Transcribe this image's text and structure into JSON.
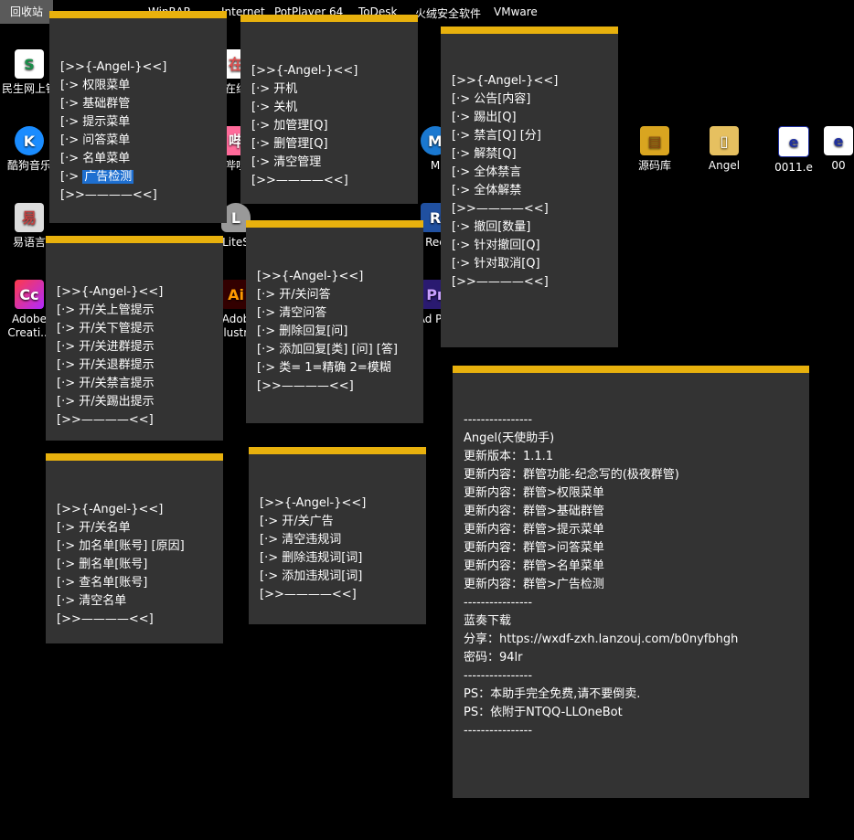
{
  "desktop": {
    "recycle_bin": "回收站",
    "top_labels": [
      "WinRAR",
      "Internet",
      "PotPlayer 64",
      "ToDesk",
      "火绒安全软件",
      "VMware"
    ],
    "icons": [
      {
        "label": "民生网上银",
        "icon": "bank-icon",
        "color": "#1a8f4a",
        "char": "S"
      },
      {
        "label": "酷狗音乐",
        "icon": "kugou-icon",
        "color": "#1a8cff",
        "char": "K"
      },
      {
        "label": "易语言",
        "icon": "eyuyan-icon",
        "color": "#c04040",
        "char": "易"
      },
      {
        "label": "Adobe Creati...",
        "icon": "adobe-cc-icon",
        "color": "#e8336f",
        "char": "Cc"
      },
      {
        "label": "在线",
        "icon": "app-icon",
        "color": "#e05050",
        "char": "在"
      },
      {
        "label": "哔哩",
        "icon": "bilibili-icon",
        "color": "#ff6a9a",
        "char": "哔"
      },
      {
        "label": "LiteS",
        "icon": "db-icon",
        "color": "#888888",
        "char": "L"
      },
      {
        "label": "Adob Illustra",
        "icon": "illustrator-icon",
        "color": "#ff9a00",
        "char": "Ai"
      },
      {
        "label": "M",
        "icon": "app-icon-m",
        "color": "#1a78d0",
        "char": "M"
      },
      {
        "label": "Rec",
        "icon": "rec-icon",
        "color": "#2050a0",
        "char": "R"
      },
      {
        "label": "Ad Pre",
        "icon": "premiere-icon",
        "color": "#2a1a70",
        "char": "Pr"
      },
      {
        "label": "源码库",
        "icon": "folder-zip-icon",
        "color": "#d9a520",
        "char": "▤"
      },
      {
        "label": "Angel",
        "icon": "folder-icon",
        "color": "#e6c060",
        "char": "▯"
      },
      {
        "label": "0011.e",
        "icon": "e-file-icon",
        "color": "#2030a0",
        "char": "e"
      },
      {
        "label": "00",
        "icon": "e-file-icon-2",
        "color": "#2030a0",
        "char": "e"
      }
    ]
  },
  "panels": {
    "permissions": [
      "[>>{-Angel-}<<]",
      "[·> 权限菜单",
      "[·> 基础群管",
      "[·> 提示菜单",
      "[·> 问答菜单",
      "[·> 名单菜单",
      "[·> ",
      "[>>————<<]"
    ],
    "permissions_highlight": "广告检测",
    "basic": [
      "[>>{-Angel-}<<]",
      "[·> 开机",
      "[·> 关机",
      "[·> 加管理[Q]",
      "[·> 删管理[Q]",
      "[·> 清空管理",
      "[>>————<<]"
    ],
    "group": [
      "[>>{-Angel-}<<]",
      "[·> 公告[内容]",
      "[·> 踢出[Q]",
      "[·> 禁言[Q] [分]",
      "[·> 解禁[Q]",
      "[·> 全体禁言",
      "[·> 全体解禁",
      "[>>————<<]",
      "[·> 撤回[数量]",
      "[·> 针对撤回[Q]",
      "[·> 针对取消[Q]",
      "[>>————<<]"
    ],
    "tips": [
      "[>>{-Angel-}<<]",
      "[·> 开/关上管提示",
      "[·> 开/关下管提示",
      "[·> 开/关进群提示",
      "[·> 开/关退群提示",
      "[·> 开/关禁言提示",
      "[·> 开/关踢出提示",
      "[>>————<<]"
    ],
    "qa": [
      "[>>{-Angel-}<<]",
      "[·> 开/关问答",
      "[·> 清空问答",
      "[·> 删除回复[问]",
      "[·> 添加回复[类] [问] [答]",
      "[·> 类= 1=精确 2=模糊",
      "[>>————<<]"
    ],
    "list": [
      "[>>{-Angel-}<<]",
      "[·> 开/关名单",
      "[·> 加名单[账号] [原因]",
      "[·> 删名单[账号]",
      "[·> 查名单[账号]",
      "[·> 清空名单",
      "[>>————<<]"
    ],
    "ads": [
      "[>>{-Angel-}<<]",
      "[·> 开/关广告",
      "[·> 清空违规词",
      "[·> 删除违规词[词]",
      "[·> 添加违规词[词]",
      "[>>————<<]"
    ],
    "info": [
      "----------------",
      "Angel(天使助手)",
      "更新版本：1.1.1",
      "更新内容：群管功能-纪念写的(极夜群管)",
      "更新内容：群管>权限菜单",
      "更新内容：群管>基础群管",
      "更新内容：群管>提示菜单",
      "更新内容：群管>问答菜单",
      "更新内容：群管>名单菜单",
      "更新内容：群管>广告检测",
      "----------------",
      "蓝奏下载",
      "分享：https://wxdf-zxh.lanzouj.com/b0nyfbhgh",
      "密码：94lr",
      "----------------",
      "PS：本助手完全免费,请不要倒卖.",
      "PS：依附于NTQQ-LLOneBot",
      "----------------"
    ]
  },
  "colors": {
    "accent": "#e8b10d",
    "panel_bg": "#333333",
    "highlight": "#1e6fd0"
  }
}
